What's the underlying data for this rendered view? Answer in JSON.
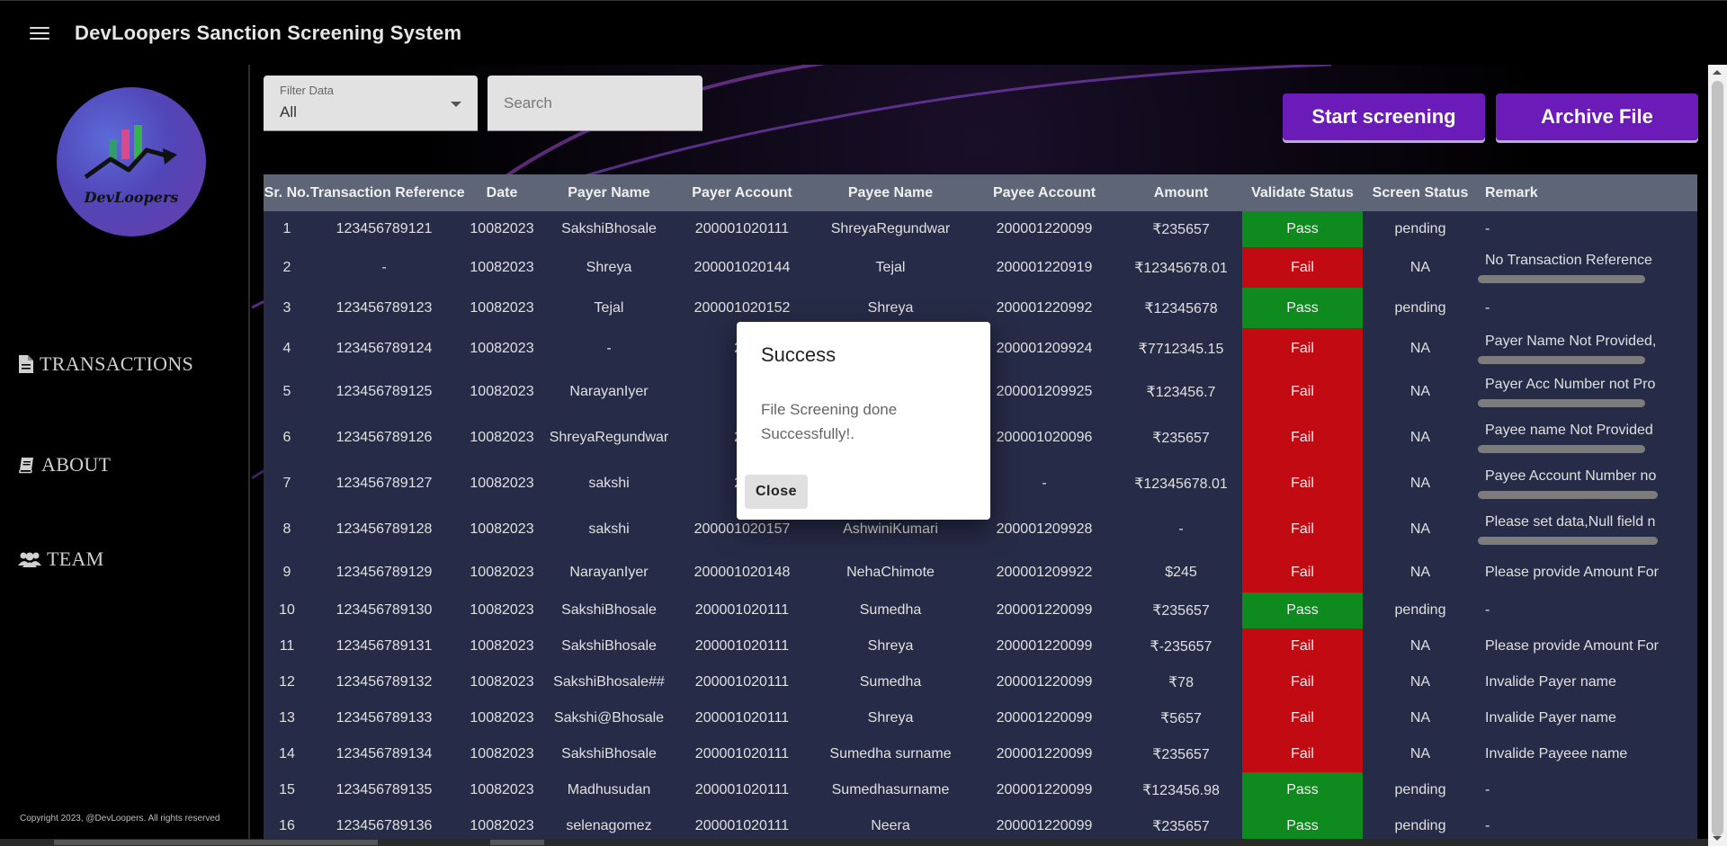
{
  "app": {
    "title": "DevLoopers Sanction Screening System"
  },
  "sidebar": {
    "logo_text": "DevLoopers",
    "items": [
      {
        "label": "TRANSACTIONS",
        "icon": "file-icon"
      },
      {
        "label": "ABOUT",
        "icon": "book-icon"
      },
      {
        "label": "TEAM",
        "icon": "users-icon"
      }
    ],
    "copyright": "Copyright 2023, @DevLoopers. All rights reserved"
  },
  "toolbar": {
    "filter_label": "Filter Data",
    "filter_value": "All",
    "search_placeholder": "Search",
    "start_label": "Start screening",
    "archive_label": "Archive File"
  },
  "table": {
    "headers": [
      "Sr. No.",
      "Transaction Reference",
      "Date",
      "Payer Name",
      "Payer Account",
      "Payee Name",
      "Payee Account",
      "Amount",
      "Validate Status",
      "Screen Status",
      "Remark"
    ],
    "rows": [
      {
        "sr": "1",
        "ref": "123456789121",
        "date": "10082023",
        "payer": "SakshiBhosale",
        "payer_acc": "200001020111",
        "payee": "ShreyaRegundwar",
        "payee_acc": "200001220099",
        "amount": "₹235657",
        "validate": "Pass",
        "screen": "pending",
        "remark": "-",
        "remark_bar": false
      },
      {
        "sr": "2",
        "ref": "-",
        "date": "10082023",
        "payer": "Shreya",
        "payer_acc": "200001020144",
        "payee": "Tejal",
        "payee_acc": "200001220919",
        "amount": "₹12345678.01",
        "validate": "Fail",
        "screen": "NA",
        "remark": "No Transaction Reference",
        "remark_bar": true
      },
      {
        "sr": "3",
        "ref": "123456789123",
        "date": "10082023",
        "payer": "Tejal",
        "payer_acc": "200001020152",
        "payee": "Shreya",
        "payee_acc": "200001220992",
        "amount": "₹12345678",
        "validate": "Pass",
        "screen": "pending",
        "remark": "-",
        "remark_bar": false
      },
      {
        "sr": "4",
        "ref": "123456789124",
        "date": "10082023",
        "payer": "-",
        "payer_acc": "20",
        "payee": "",
        "payee_acc": "200001209924",
        "amount": "₹7712345.15",
        "validate": "Fail",
        "screen": "NA",
        "remark": "Payer Name Not Provided,",
        "remark_bar": true
      },
      {
        "sr": "5",
        "ref": "123456789125",
        "date": "10082023",
        "payer": "NarayanIyer",
        "payer_acc": "",
        "payee": "",
        "payee_acc": "200001209925",
        "amount": "₹123456.7",
        "validate": "Fail",
        "screen": "NA",
        "remark": "Payer Acc Number not Pro",
        "remark_bar": true
      },
      {
        "sr": "6",
        "ref": "123456789126",
        "date": "10082023",
        "payer": "ShreyaRegundwar",
        "payer_acc": "20",
        "payee": "",
        "payee_acc": "200001020096",
        "amount": "₹235657",
        "validate": "Fail",
        "screen": "NA",
        "remark": "Payee name Not Provided",
        "remark_bar": true
      },
      {
        "sr": "7",
        "ref": "123456789127",
        "date": "10082023",
        "payer": "sakshi",
        "payer_acc": "20",
        "payee": "",
        "payee_acc": "-",
        "amount": "₹12345678.01",
        "validate": "Fail",
        "screen": "NA",
        "remark": "Payee Account Number no",
        "remark_bar": true
      },
      {
        "sr": "8",
        "ref": "123456789128",
        "date": "10082023",
        "payer": "sakshi",
        "payer_acc": "200001020157",
        "payee": "AshwiniKumari",
        "payee_acc": "200001209928",
        "amount": "-",
        "validate": "Fail",
        "screen": "NA",
        "remark": "Please set data,Null field n",
        "remark_bar": true
      },
      {
        "sr": "9",
        "ref": "123456789129",
        "date": "10082023",
        "payer": "NarayanIyer",
        "payer_acc": "200001020148",
        "payee": "NehaChimote",
        "payee_acc": "200001209922",
        "amount": "$245",
        "validate": "Fail",
        "screen": "NA",
        "remark": "Please provide Amount For",
        "remark_bar": false
      },
      {
        "sr": "10",
        "ref": "123456789130",
        "date": "10082023",
        "payer": "SakshiBhosale",
        "payer_acc": "200001020111",
        "payee": "Sumedha",
        "payee_acc": "200001220099",
        "amount": "₹235657",
        "validate": "Pass",
        "screen": "pending",
        "remark": "-",
        "remark_bar": false
      },
      {
        "sr": "11",
        "ref": "123456789131",
        "date": "10082023",
        "payer": "SakshiBhosale",
        "payer_acc": "200001020111",
        "payee": "Shreya",
        "payee_acc": "200001220099",
        "amount": "₹-235657",
        "validate": "Fail",
        "screen": "NA",
        "remark": "Please provide Amount For",
        "remark_bar": false
      },
      {
        "sr": "12",
        "ref": "123456789132",
        "date": "10082023",
        "payer": "SakshiBhosale##",
        "payer_acc": "200001020111",
        "payee": "Sumedha",
        "payee_acc": "200001220099",
        "amount": "₹78",
        "validate": "Fail",
        "screen": "NA",
        "remark": "Invalide Payer name",
        "remark_bar": false
      },
      {
        "sr": "13",
        "ref": "123456789133",
        "date": "10082023",
        "payer": "Sakshi@Bhosale",
        "payer_acc": "200001020111",
        "payee": "Shreya",
        "payee_acc": "200001220099",
        "amount": "₹5657",
        "validate": "Fail",
        "screen": "NA",
        "remark": "Invalide Payer name",
        "remark_bar": false
      },
      {
        "sr": "14",
        "ref": "123456789134",
        "date": "10082023",
        "payer": "SakshiBhosale",
        "payer_acc": "200001020111",
        "payee": "Sumedha surname",
        "payee_acc": "200001220099",
        "amount": "₹235657",
        "validate": "Fail",
        "screen": "NA",
        "remark": "Invalide Payeee name",
        "remark_bar": false
      },
      {
        "sr": "15",
        "ref": "123456789135",
        "date": "10082023",
        "payer": "Madhusudan",
        "payer_acc": "200001020111",
        "payee": "Sumedhasurname",
        "payee_acc": "200001220099",
        "amount": "₹123456.98",
        "validate": "Pass",
        "screen": "pending",
        "remark": "-",
        "remark_bar": false
      },
      {
        "sr": "16",
        "ref": "123456789136",
        "date": "10082023",
        "payer": "selenagomez",
        "payer_acc": "200001020111",
        "payee": "Neera",
        "payee_acc": "200001220099",
        "amount": "₹235657",
        "validate": "Pass",
        "screen": "pending",
        "remark": "-",
        "remark_bar": false
      }
    ]
  },
  "dialog": {
    "title": "Success",
    "message": "File Screening done Successfully!.",
    "close_label": "Close"
  },
  "colors": {
    "header_bg": "#5e6577",
    "row_bg": "#262b47",
    "pass": "#0f8a1f",
    "fail": "#c20a12",
    "button": "#6a1bb8"
  }
}
